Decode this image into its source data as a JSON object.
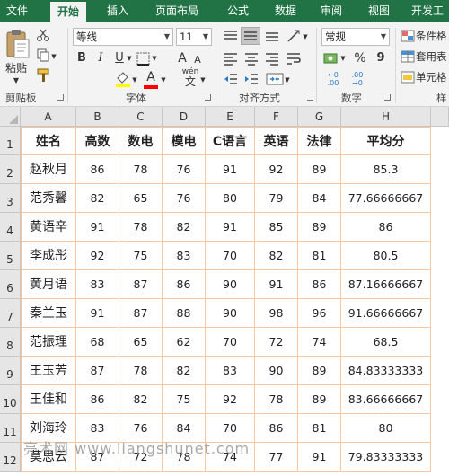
{
  "ribbon": {
    "tabs": [
      "文件",
      "开始",
      "插入",
      "页面布局",
      "公式",
      "数据",
      "审阅",
      "视图",
      "开发工"
    ],
    "active_tab": "开始",
    "font_name": "等线",
    "font_size": "11",
    "number_format": "常规",
    "paste_label": "粘贴",
    "bold_label": "B",
    "italic_label": "I",
    "underline_label": "U",
    "increase_font": "A",
    "decrease_font": "A",
    "wen_label": "wén",
    "wen_char": "文",
    "percent": "%",
    "comma": "9",
    "style_items": [
      "条件格",
      "套用表",
      "单元格"
    ],
    "groups": {
      "clipboard": "剪贴板",
      "font": "字体",
      "alignment": "对齐方式",
      "number": "数字",
      "styles": "样"
    },
    "colors": {
      "tab_bar": "#217346",
      "highlight": "#ffff00",
      "font_color": "#ff0000"
    }
  },
  "sheet": {
    "columns": [
      "A",
      "B",
      "C",
      "D",
      "E",
      "F",
      "G",
      "H"
    ],
    "rows": [
      "1",
      "2",
      "3",
      "4",
      "5",
      "6",
      "7",
      "8",
      "9",
      "10",
      "11",
      "12"
    ],
    "headers": [
      "姓名",
      "高数",
      "数电",
      "模电",
      "C语言",
      "英语",
      "法律",
      "平均分"
    ],
    "data": [
      [
        "赵秋月",
        "86",
        "78",
        "76",
        "91",
        "92",
        "89",
        "85.3"
      ],
      [
        "范秀馨",
        "82",
        "65",
        "76",
        "80",
        "79",
        "84",
        "77.66666667"
      ],
      [
        "黄语辛",
        "91",
        "78",
        "82",
        "91",
        "85",
        "89",
        "86"
      ],
      [
        "李成彤",
        "92",
        "75",
        "83",
        "70",
        "82",
        "81",
        "80.5"
      ],
      [
        "黄月语",
        "83",
        "87",
        "86",
        "90",
        "91",
        "86",
        "87.16666667"
      ],
      [
        "秦兰玉",
        "91",
        "87",
        "88",
        "90",
        "98",
        "96",
        "91.66666667"
      ],
      [
        "范振理",
        "68",
        "65",
        "62",
        "70",
        "72",
        "74",
        "68.5"
      ],
      [
        "王玉芳",
        "87",
        "78",
        "82",
        "83",
        "90",
        "89",
        "84.83333333"
      ],
      [
        "王佳和",
        "86",
        "82",
        "75",
        "92",
        "78",
        "89",
        "83.66666667"
      ],
      [
        "刘海玲",
        "83",
        "76",
        "84",
        "70",
        "86",
        "81",
        "80"
      ],
      [
        "莫思云",
        "87",
        "72",
        "78",
        "74",
        "77",
        "91",
        "79.83333333"
      ]
    ],
    "grid_color": "#f3c6a4"
  },
  "watermark": "亮术网 www.liangshunet.com"
}
